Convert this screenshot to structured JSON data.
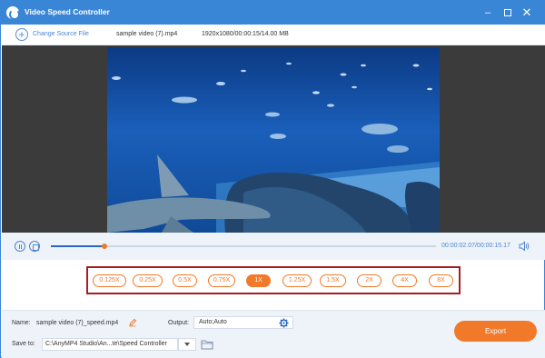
{
  "window": {
    "title": "Video Speed Controller"
  },
  "toolbar": {
    "change_source_label": "Change Source File",
    "file_name": "sample video (7).mp4",
    "file_meta": "1920x1080/00:00:15/14.00 MB"
  },
  "playback": {
    "current_time": "00:00:02.07",
    "total_time": "00:00:15.17",
    "time_display": "00:00:02.07/00:00:15.17",
    "progress_fraction": 0.14
  },
  "speed": {
    "options": [
      "0.125X",
      "0.25X",
      "0.5X",
      "0.75X",
      "1X",
      "1.25X",
      "1.5X",
      "2X",
      "4X",
      "8X"
    ],
    "selected": "1X"
  },
  "settings": {
    "name_label": "Name:",
    "name_value": "sample video (7)_speed.mp4",
    "output_label": "Output:",
    "output_value": "Auto;Auto",
    "save_to_label": "Save to:",
    "save_to_value": "C:\\AnyMP4 Studio\\An...te\\Speed Controller"
  },
  "export_label": "Export",
  "colors": {
    "accent": "#3a86d6",
    "orange": "#f07a2a",
    "highlight_border": "#a61e22"
  },
  "icons": [
    "app-logo-icon",
    "minimize-icon",
    "maximize-icon",
    "close-icon",
    "add-file-icon",
    "pause-icon",
    "stop-icon",
    "volume-icon",
    "edit-icon",
    "gear-icon",
    "chevron-down-icon",
    "folder-icon"
  ]
}
